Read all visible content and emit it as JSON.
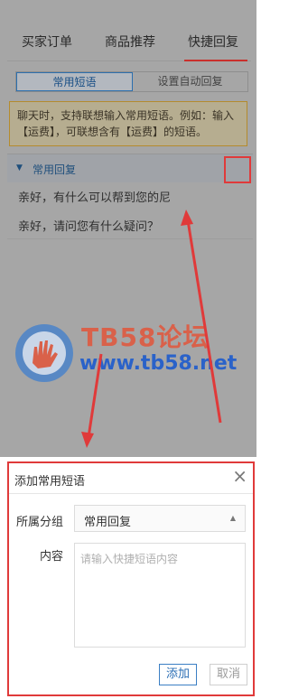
{
  "tabs": [
    {
      "label": "买家订单"
    },
    {
      "label": "商品推荐"
    },
    {
      "label": "快捷回复"
    }
  ],
  "segments": {
    "common": "常用短语",
    "auto": "设置自动回复"
  },
  "notice": "聊天时，支持联想输入常用短语。例如：输入【运费】，可联想含有【运费】的短语。",
  "group": {
    "title": "常用回复",
    "phrases": [
      "亲好，有什么可以帮到您的尼",
      "亲好，请问您有什么疑问？"
    ]
  },
  "watermark": {
    "brand": "TB58论坛",
    "url": "www.tb58.net"
  },
  "dialog": {
    "title": "添加常用短语",
    "close": "×",
    "group_label": "所属分组",
    "group_value": "常用回复",
    "content_label": "内容",
    "content_placeholder": "请输入快捷短语内容",
    "add_label": "添加",
    "cancel_label": "取消"
  },
  "colors": {
    "accent": "#2c6fb5",
    "highlight": "#e03a3a",
    "overlay": "#a6a6a6"
  }
}
